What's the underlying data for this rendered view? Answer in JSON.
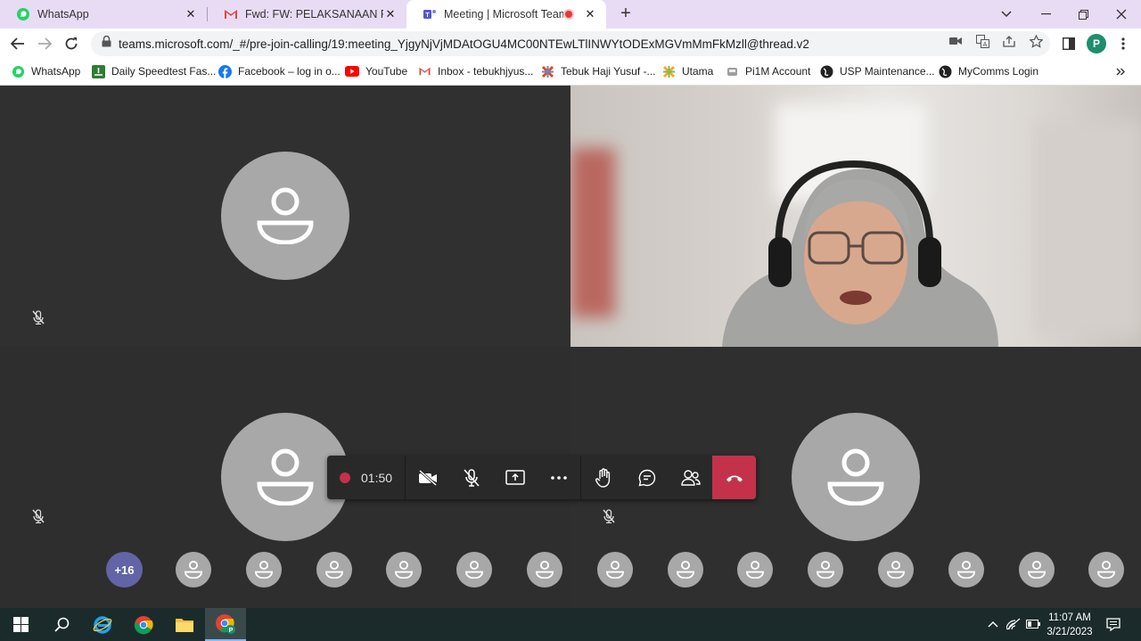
{
  "tabs": [
    {
      "title": "WhatsApp",
      "icon": "whatsapp-icon"
    },
    {
      "title": "Fwd: FW: PELAKSANAAN PROGR",
      "icon": "gmail-icon"
    },
    {
      "title": "Meeting | Microsoft Teams",
      "icon": "teams-icon",
      "active": true
    }
  ],
  "new_tab_label": "+",
  "address": {
    "url": "teams.microsoft.com/_#/pre-join-calling/19:meeting_YjgyNjVjMDAtOGU4MC00NTEwLTlINWYtODExMGVmMmFkMzll@thread.v2"
  },
  "profile_initial": "P",
  "bookmarks": [
    {
      "label": "WhatsApp",
      "icon": "whatsapp-icon"
    },
    {
      "label": "Daily Speedtest Fas...",
      "icon": "speedtest-icon"
    },
    {
      "label": "Facebook – log in o...",
      "icon": "facebook-icon"
    },
    {
      "label": "YouTube",
      "icon": "youtube-icon"
    },
    {
      "label": "Inbox - tebukhjyus...",
      "icon": "gmail-icon"
    },
    {
      "label": "Tebuk Haji Yusuf -...",
      "icon": "joomla-icon"
    },
    {
      "label": "Utama",
      "icon": "joomla-icon"
    },
    {
      "label": "Pi1M Account",
      "icon": "pi1m-icon"
    },
    {
      "label": "USP Maintenance...",
      "icon": "globe-icon"
    },
    {
      "label": "MyComms Login",
      "icon": "globe-icon"
    }
  ],
  "meeting": {
    "timer": "01:50",
    "overflow_count": "+16",
    "strip_participants": 14
  },
  "taskbar": {
    "time": "11:07 AM",
    "date": "3/21/2023"
  },
  "colors": {
    "tabstrip": "#e8dcf5",
    "teams_accent": "#6264a7",
    "hangup_red": "#c4314b"
  }
}
